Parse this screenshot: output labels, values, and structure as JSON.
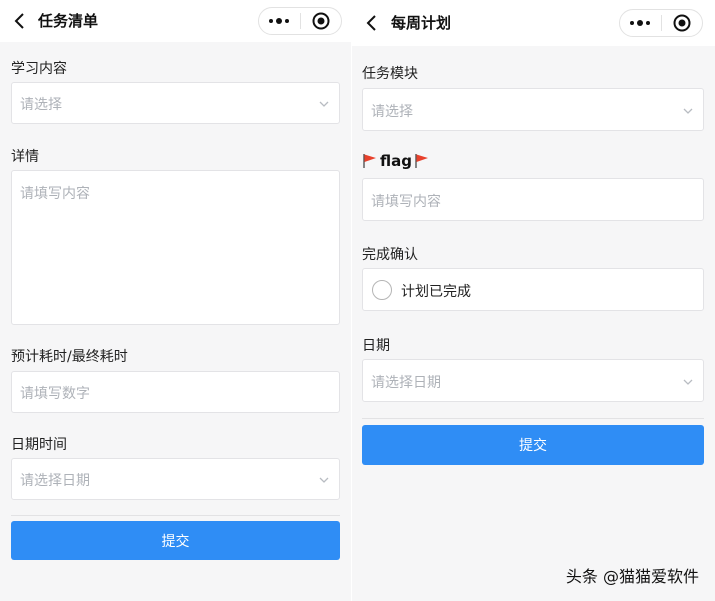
{
  "left": {
    "nav_title": "任务清单",
    "study_label": "学习内容",
    "study_placeholder": "请选择",
    "details_label": "详情",
    "details_placeholder": "请填写内容",
    "time_label": "预计耗时/最终耗时",
    "time_placeholder": "请填写数字",
    "datetime_label": "日期时间",
    "datetime_placeholder": "请选择日期",
    "submit_label": "提交"
  },
  "right": {
    "nav_title": "每周计划",
    "module_label": "任务模块",
    "module_placeholder": "请选择",
    "flag_label": "flag",
    "flag_placeholder": "请填写内容",
    "confirm_label": "完成确认",
    "confirm_option": "计划已完成",
    "date_label": "日期",
    "date_placeholder": "请选择日期",
    "submit_label": "提交"
  },
  "icons": {
    "back": "chevron-left-icon",
    "more": "more-dots-icon",
    "close": "target-icon",
    "dropdown": "chevron-down-icon",
    "flag": "red-flag-icon"
  },
  "colors": {
    "accent": "#2f8df5",
    "flag": "#e8412c",
    "placeholder": "#aeb2b8"
  },
  "watermark": "头条 @猫猫爱软件"
}
